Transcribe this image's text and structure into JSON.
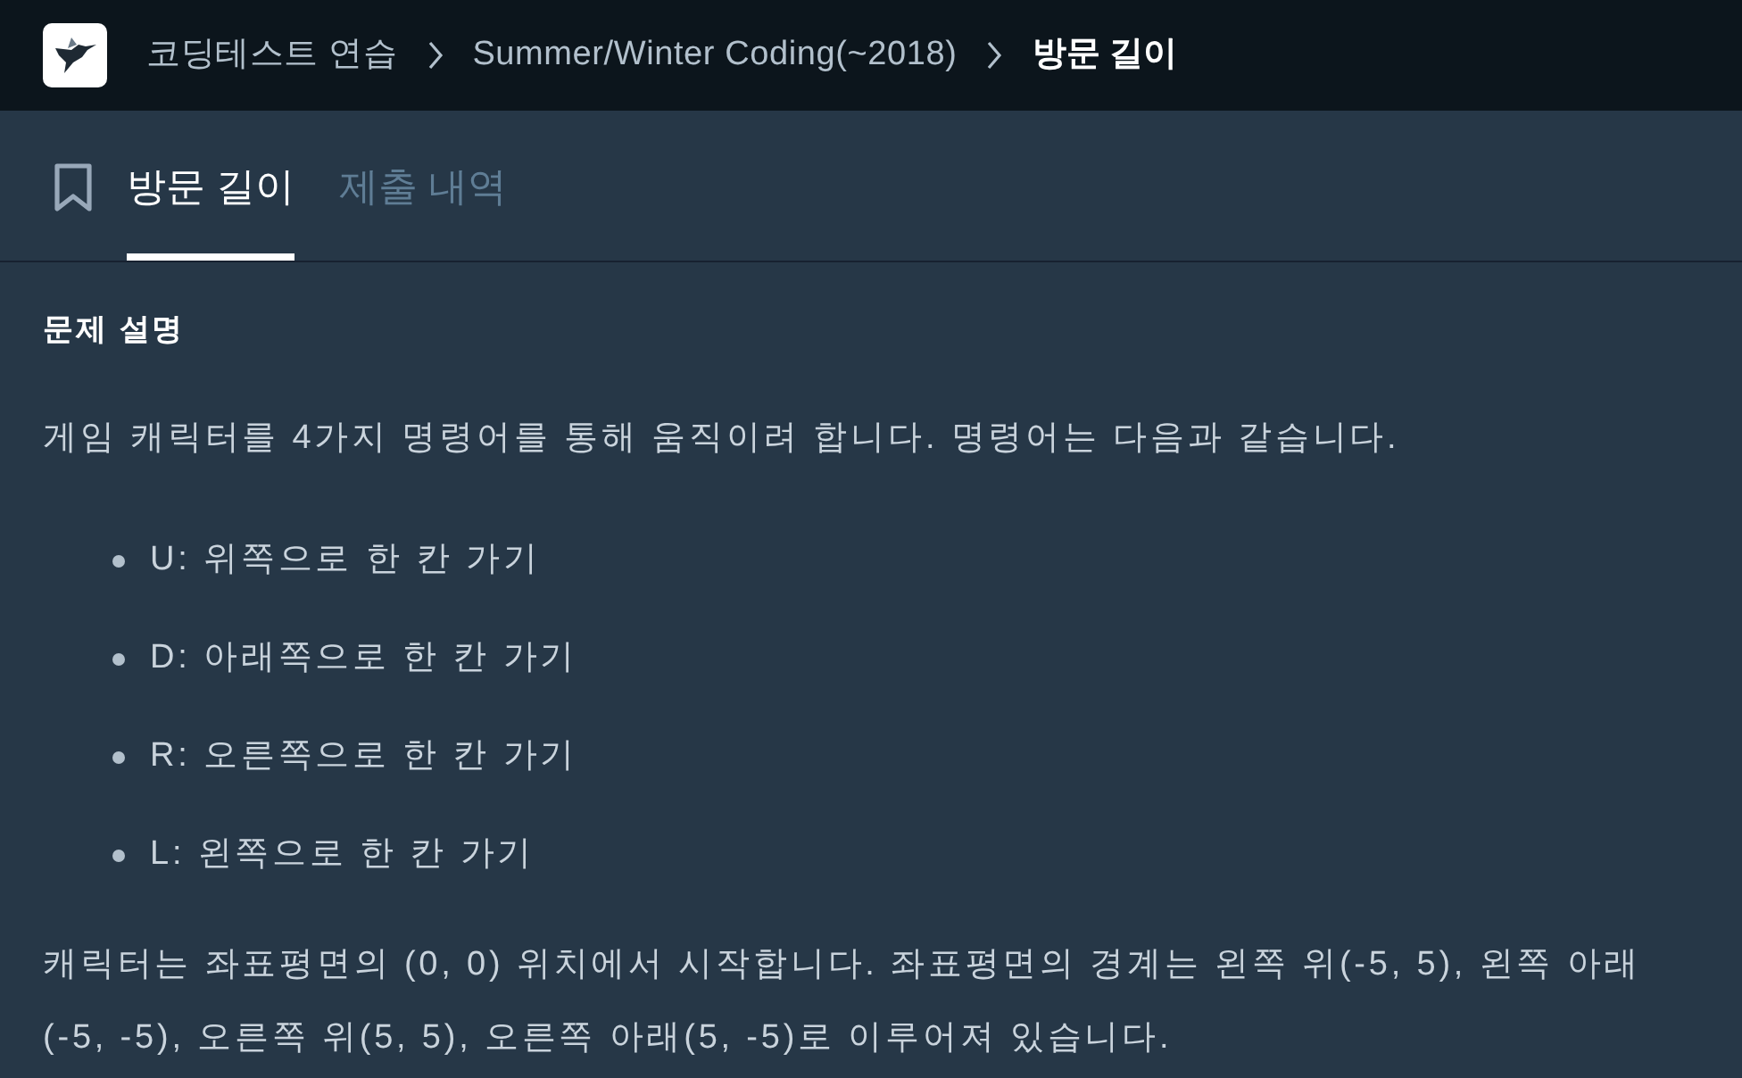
{
  "breadcrumb": [
    {
      "label": "코딩테스트 연습",
      "current": false
    },
    {
      "label": "Summer/Winter Coding(~2018)",
      "current": false
    },
    {
      "label": "방문 길이",
      "current": true
    }
  ],
  "tabs": [
    {
      "label": "방문 길이",
      "selected": true
    },
    {
      "label": "제출 내역",
      "selected": false
    }
  ],
  "description": {
    "heading": "문제 설명",
    "intro": "게임 캐릭터를 4가지 명령어를 통해 움직이려 합니다. 명령어는 다음과 같습니다.",
    "commands": [
      "U: 위쪽으로 한 칸 가기",
      "D: 아래쪽으로 한 칸 가기",
      "R: 오른쪽으로 한 칸 가기",
      "L: 왼쪽으로 한 칸 가기"
    ],
    "paragraph": "캐릭터는 좌표평면의 (0, 0) 위치에서 시작합니다. 좌표평면의 경계는 왼쪽 위(-5, 5), 왼쪽 아래 (-5, -5), 오른쪽 위(5, 5), 오른쪽 아래(5, -5)로 이루어져 있습니다."
  }
}
